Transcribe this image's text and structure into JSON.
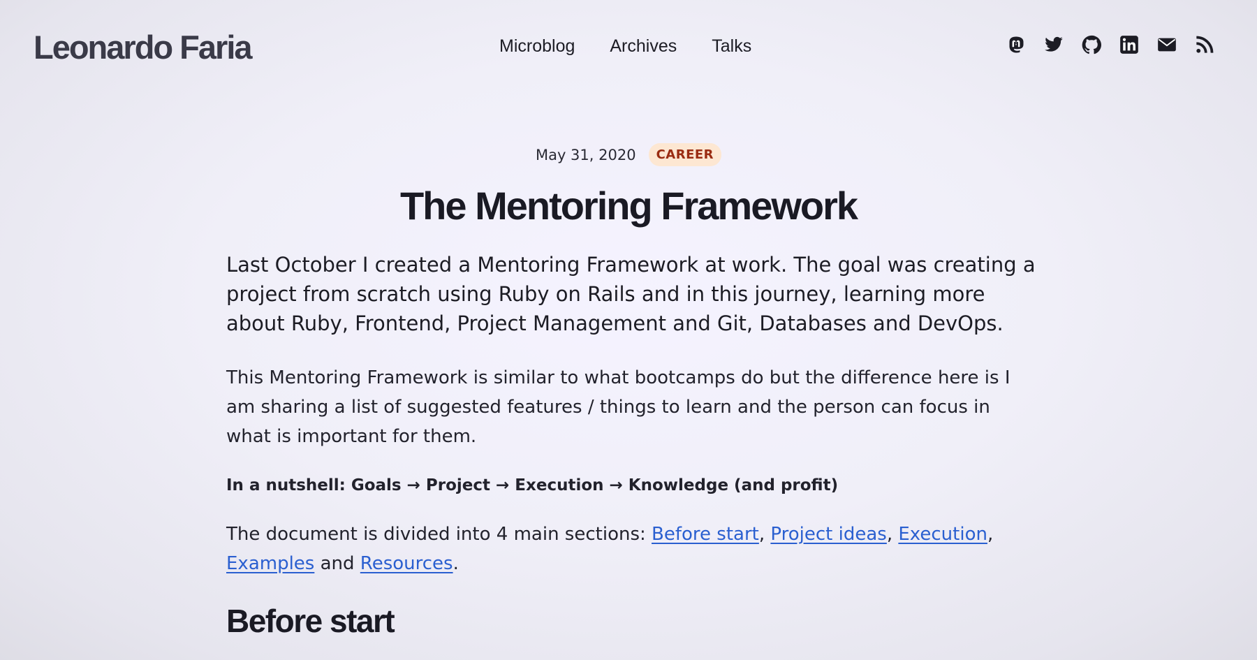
{
  "header": {
    "site_title": "Leonardo Faria",
    "nav": [
      "Microblog",
      "Archives",
      "Talks"
    ],
    "social_icons": [
      "mastodon-icon",
      "twitter-icon",
      "github-icon",
      "linkedin-icon",
      "email-icon",
      "rss-icon"
    ]
  },
  "post": {
    "date": "May 31, 2020",
    "tag": "CAREER",
    "title": "The Mentoring Framework",
    "intro": "Last October I created a Mentoring Framework at work. The goal was creating a project from scratch using Ruby on Rails and in this journey, learning more about Ruby, Frontend, Project Management and Git, Databases and DevOps.",
    "para2": "This Mentoring Framework is similar to what bootcamps do but the difference here is I am sharing a list of suggested features / things to learn and the person can focus in what is important for them.",
    "nutshell": "In a nutshell: Goals → Project → Execution → Knowledge (and profit)",
    "sections_intro": "The document is divided into 4 main sections:",
    "section_links": [
      "Before start",
      "Project ideas",
      "Execution",
      "Examples",
      "Resources"
    ],
    "sep_comma": ",",
    "sep_and": "and",
    "sep_period": ".",
    "heading_before_start": "Before start"
  },
  "colors": {
    "link": "#2a5fd0",
    "tag_bg": "#fde7d2",
    "tag_text": "#9a2c12",
    "text": "#1c1c24"
  }
}
